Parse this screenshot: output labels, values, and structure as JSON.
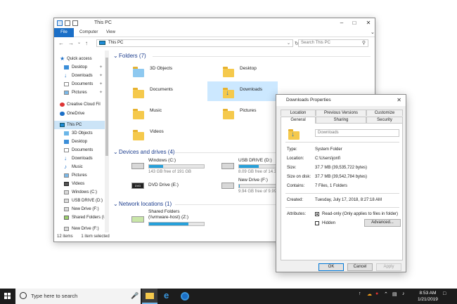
{
  "explorer": {
    "title": "This PC",
    "ribbon_tabs": [
      "File",
      "Computer",
      "View"
    ],
    "address": "This PC",
    "search_placeholder": "Search This PC",
    "sidebar": [
      {
        "label": "Quick access",
        "icon": "star-icon"
      },
      {
        "label": "Desktop",
        "icon": "desktop-icon",
        "pinned": true
      },
      {
        "label": "Downloads",
        "icon": "download-icon",
        "pinned": true
      },
      {
        "label": "Documents",
        "icon": "documents-icon",
        "pinned": true
      },
      {
        "label": "Pictures",
        "icon": "pictures-icon",
        "pinned": true
      },
      {
        "label": "Creative Cloud Fil",
        "icon": "creative-cloud-icon"
      },
      {
        "label": "OneDrive",
        "icon": "onedrive-icon"
      },
      {
        "label": "This PC",
        "icon": "pc-icon",
        "selected": true
      },
      {
        "label": "3D Objects",
        "icon": "3d-objects-icon"
      },
      {
        "label": "Desktop",
        "icon": "desktop-icon"
      },
      {
        "label": "Documents",
        "icon": "documents-icon"
      },
      {
        "label": "Downloads",
        "icon": "download-icon"
      },
      {
        "label": "Music",
        "icon": "music-icon"
      },
      {
        "label": "Pictures",
        "icon": "pictures-icon"
      },
      {
        "label": "Videos",
        "icon": "videos-icon"
      },
      {
        "label": "Windows (C:)",
        "icon": "drive-icon"
      },
      {
        "label": "USB DRIVE (D:)",
        "icon": "drive-icon"
      },
      {
        "label": "New Drive (F:)",
        "icon": "drive-icon"
      },
      {
        "label": "Shared Folders (\\",
        "icon": "network-drive-icon"
      },
      {
        "label": "New Drive (F:)",
        "icon": "drive-icon"
      }
    ],
    "folders_header": "Folders (7)",
    "folders": [
      "3D Objects",
      "Desktop",
      "Documents",
      "Downloads",
      "Music",
      "Pictures",
      "Videos"
    ],
    "drives_header": "Devices and drives (4)",
    "drives": [
      {
        "name": "Windows (C:)",
        "space": "143 GB free of 191 GB",
        "used_fraction": 0.25
      },
      {
        "name": "USB DRIVE (D:)",
        "space": "8.09 GB free of 14.3 GB",
        "used_fraction": 0.43
      },
      {
        "name": "DVD Drive (E:)",
        "space": "",
        "used_fraction": null
      },
      {
        "name": "New Drive (F:)",
        "space": "9.94 GB free of 9.99 GB",
        "used_fraction": 0.01
      }
    ],
    "network_header": "Network locations (1)",
    "network": [
      {
        "name": "Shared Folders",
        "path": "(\\\\vmware-host) (Z:)",
        "used_fraction": 0.72
      }
    ],
    "status_items": "12 items",
    "status_selected": "1 item selected"
  },
  "props": {
    "title": "Downloads Properties",
    "tabs_row1": [
      "Location",
      "Previous Versions",
      "Customize"
    ],
    "tabs_row2": [
      "General",
      "Sharing",
      "Security"
    ],
    "name": "Downloads",
    "fields": [
      {
        "label": "Type:",
        "value": "System Folder"
      },
      {
        "label": "Location:",
        "value": "C:\\Users\\jonfi"
      },
      {
        "label": "Size:",
        "value": "37.7 MB (39,535,722 bytes)"
      },
      {
        "label": "Size on disk:",
        "value": "37.7 MB (39,542,784 bytes)"
      },
      {
        "label": "Contains:",
        "value": "7 Files, 1 Folders"
      },
      {
        "label": "Created:",
        "value": "Tuesday, July 17, 2018, 8:27:18 AM"
      }
    ],
    "attributes_label": "Attributes:",
    "readonly_label": "Read-only (Only applies to files in folder)",
    "hidden_label": "Hidden",
    "advanced_button": "Advanced...",
    "ok": "OK",
    "cancel": "Cancel",
    "apply": "Apply"
  },
  "taskbar": {
    "search_text": "Type here to search",
    "time": "8:53 AM",
    "date": "1/21/2019"
  },
  "colors": {
    "accent": "#1b6fc7",
    "selection": "#cce8ff",
    "drive_bar": "#26a0da",
    "taskbar": "#1c1c1c"
  }
}
